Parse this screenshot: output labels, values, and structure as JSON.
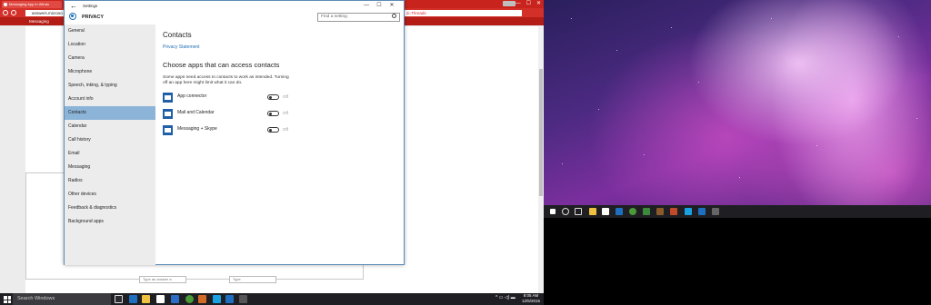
{
  "browser": {
    "tab_title": "Messaging App in Windo",
    "tab_close": "✕",
    "address_text": "answers.microso",
    "address_right_text": "d=Threads",
    "bookmark_messaging": "Messaging",
    "window_buttons": [
      "—",
      "☐",
      "✕"
    ]
  },
  "page": {
    "input_1": "Type an answer a",
    "input_2": "Type"
  },
  "taskbar": {
    "search_placeholder": "Search Windows",
    "tray_icons": "^ ▭ ◁) ▬",
    "time": "8:05 AM",
    "date": "12/5/2015"
  },
  "settings": {
    "window_title": "Settings",
    "back_glyph": "←",
    "min_glyph": "—",
    "max_glyph": "☐",
    "close_glyph": "✕",
    "section_title": "PRIVACY",
    "find_placeholder": "Find a setting",
    "nav_items": [
      {
        "label": "General"
      },
      {
        "label": "Location"
      },
      {
        "label": "Camera"
      },
      {
        "label": "Microphone"
      },
      {
        "label": "Speech, inking, & typing"
      },
      {
        "label": "Account info"
      },
      {
        "label": "Contacts"
      },
      {
        "label": "Calendar"
      },
      {
        "label": "Call history"
      },
      {
        "label": "Email"
      },
      {
        "label": "Messaging"
      },
      {
        "label": "Radios"
      },
      {
        "label": "Other devices"
      },
      {
        "label": "Feedback & diagnostics"
      },
      {
        "label": "Background apps"
      }
    ],
    "active_nav": "Contacts",
    "content": {
      "title": "Contacts",
      "privacy_link": "Privacy Statement",
      "heading": "Choose apps that can access contacts",
      "description": "Some apps need access to contacts to work as intended. Turning off an app here might limit what it can do.",
      "apps": [
        {
          "name": "App connector",
          "state": "Off",
          "icon": "app-connector-icon"
        },
        {
          "name": "Mail and Calendar",
          "state": "Off",
          "icon": "mail-icon"
        },
        {
          "name": "Messaging + Skype",
          "state": "Off",
          "icon": "messaging-icon"
        }
      ]
    }
  },
  "colors": {
    "accent": "#1f6fb4",
    "active_nav": "#8cb4d8",
    "browser_red": "#c8241d",
    "taskbar": "#1f1f23"
  }
}
